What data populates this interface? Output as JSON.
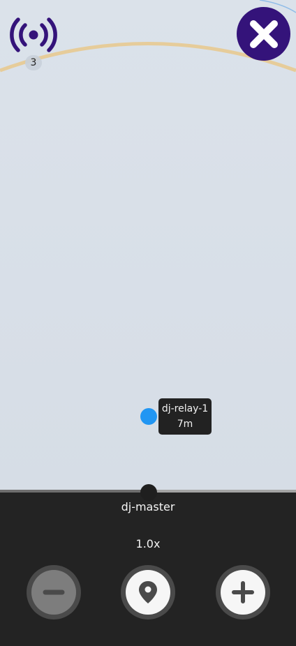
{
  "colors": {
    "accent": "#34137a",
    "peer_dot": "#2196f3",
    "range_ring": "#e6cc9a",
    "outer_ring": "#8fbce8",
    "panel": "#232323"
  },
  "header": {
    "signal_icon": "broadcast-signal-icon",
    "peer_count": "3",
    "close_icon": "close-x-icon"
  },
  "map": {
    "peers": [
      {
        "name": "dj-relay-1",
        "distance": "7m"
      }
    ]
  },
  "player": {
    "device_name": "dj-master",
    "zoom": "1.0x",
    "progress_fraction": 0.5,
    "controls": {
      "zoom_out_icon": "minus-icon",
      "locate_icon": "map-pin-icon",
      "zoom_in_icon": "plus-icon"
    }
  }
}
